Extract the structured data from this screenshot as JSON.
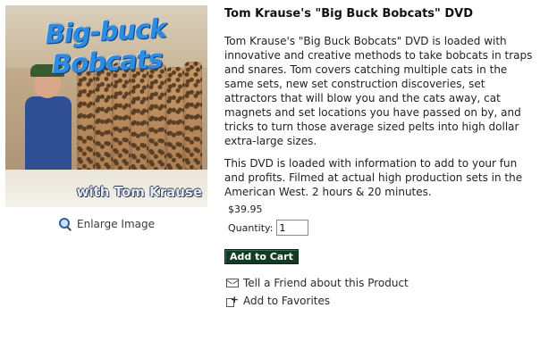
{
  "product": {
    "title": "Tom Krause's \"Big Buck Bobcats\" DVD",
    "description_1": "Tom Krause's \"Big Buck Bobcats\" DVD is loaded with innovative and creative methods to take bobcats in traps and snares.  Tom covers catching multiple cats in the same sets, new set construction discoveries, set attractors that will blow you and the cats away, cat magnets and set locations you have passed on by, and tricks to turn those average sized pelts into high dollar extra-large sizes.",
    "description_2": "This DVD is loaded with information to add to your fun and profits.  Filmed at actual high production sets in the American West.  2 hours & 20 minutes.",
    "price": "$39.95",
    "quantity_label": "Quantity:",
    "quantity_value": "1",
    "add_to_cart_label": "Add to Cart"
  },
  "image": {
    "cover_title": "Big-buck Bobcats",
    "cover_byline": "with Tom Krause",
    "enlarge_label": "Enlarge Image",
    "enlarge_icon": "magnifier-icon"
  },
  "links": {
    "tell_friend": "Tell a Friend about this Product",
    "tell_friend_icon": "envelope-icon",
    "add_favorites": "Add to Favorites",
    "add_favorites_icon": "add-favorite-icon"
  },
  "colors": {
    "button_bg": "#123a24",
    "cover_title": "#2d8be0"
  }
}
